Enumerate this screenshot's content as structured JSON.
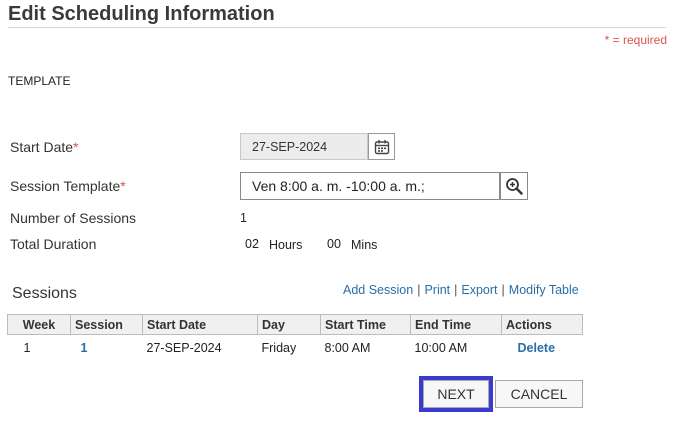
{
  "header": {
    "title": "Edit Scheduling Information",
    "required_note": "* = required"
  },
  "section_label": "TEMPLATE",
  "form": {
    "start_date_label": "Start Date",
    "start_date_value": "27-SEP-2024",
    "session_template_label": "Session Template",
    "session_template_value": "Ven 8:00 a. m. -10:00 a. m.;",
    "num_sessions_label": "Number of Sessions",
    "num_sessions_value": "1",
    "total_duration_label": "Total Duration",
    "hours_value": "02",
    "hours_unit": "Hours",
    "mins_value": "00",
    "mins_unit": "Mins",
    "required_mark": "*"
  },
  "sessions": {
    "title": "Sessions",
    "links": [
      "Add Session",
      "Print",
      "Export",
      "Modify Table"
    ],
    "separator": "|",
    "columns": [
      "Week",
      "Session",
      "Start Date",
      "Day",
      "Start Time",
      "End Time",
      "Actions"
    ],
    "rows": [
      {
        "week": "1",
        "session": "1",
        "start_date": "27-SEP-2024",
        "day": "Friday",
        "start_time": "8:00 AM",
        "end_time": "10:00 AM",
        "action": "Delete"
      }
    ]
  },
  "buttons": {
    "next": "NEXT",
    "cancel": "CANCEL"
  },
  "icons": {
    "calendar": "calendar-icon",
    "search": "magnifier-icon"
  },
  "colors": {
    "link": "#2a6ea6",
    "required": "#d9534f",
    "focus_outline": "#3a3ad0"
  }
}
